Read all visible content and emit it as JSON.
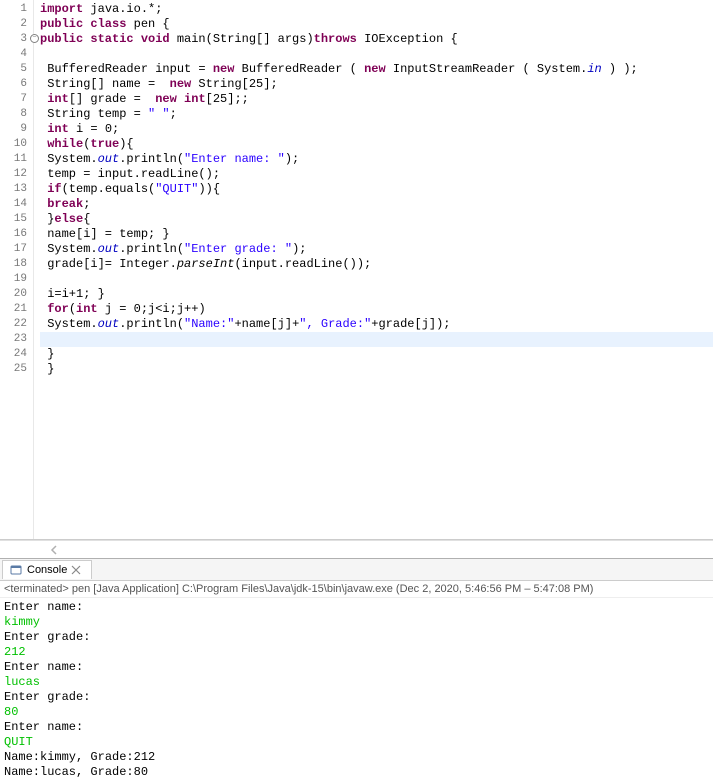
{
  "editor": {
    "lines": [
      {
        "n": 1,
        "tokens": [
          [
            "kw",
            "import"
          ],
          [
            "type",
            " java.io.*;"
          ]
        ]
      },
      {
        "n": 2,
        "tokens": [
          [
            "kw",
            "public class"
          ],
          [
            "type",
            " pen {"
          ]
        ]
      },
      {
        "n": 3,
        "fold": true,
        "tokens": [
          [
            "kw",
            "public static void"
          ],
          [
            "type",
            " main(String[] args)"
          ],
          [
            "kw",
            "throws"
          ],
          [
            "type",
            " IOException {"
          ]
        ]
      },
      {
        "n": 4,
        "tokens": []
      },
      {
        "n": 5,
        "tokens": [
          [
            "type",
            " BufferedReader input = "
          ],
          [
            "kw",
            "new"
          ],
          [
            "type",
            " BufferedReader ( "
          ],
          [
            "kw",
            "new"
          ],
          [
            "type",
            " InputStreamReader ( System."
          ],
          [
            "fld",
            "in"
          ],
          [
            "type",
            " ) );"
          ]
        ]
      },
      {
        "n": 6,
        "tokens": [
          [
            "type",
            " String[] name =  "
          ],
          [
            "kw",
            "new"
          ],
          [
            "type",
            " String[25];"
          ]
        ]
      },
      {
        "n": 7,
        "tokens": [
          [
            "kw",
            " int"
          ],
          [
            "type",
            "[] grade =  "
          ],
          [
            "kw",
            "new int"
          ],
          [
            "type",
            "[25];;"
          ]
        ]
      },
      {
        "n": 8,
        "tokens": [
          [
            "type",
            " String temp = "
          ],
          [
            "str",
            "\" \""
          ],
          [
            "type",
            ";"
          ]
        ]
      },
      {
        "n": 9,
        "tokens": [
          [
            "kw",
            " int"
          ],
          [
            "type",
            " i = 0;"
          ]
        ]
      },
      {
        "n": 10,
        "tokens": [
          [
            "kw",
            " while"
          ],
          [
            "type",
            "("
          ],
          [
            "kw",
            "true"
          ],
          [
            "type",
            "){"
          ]
        ]
      },
      {
        "n": 11,
        "tokens": [
          [
            "type",
            " System."
          ],
          [
            "fld",
            "out"
          ],
          [
            "type",
            ".println("
          ],
          [
            "str",
            "\"Enter name: \""
          ],
          [
            "type",
            ");"
          ]
        ]
      },
      {
        "n": 12,
        "tokens": [
          [
            "type",
            " temp = input.readLine();"
          ]
        ]
      },
      {
        "n": 13,
        "tokens": [
          [
            "kw",
            " if"
          ],
          [
            "type",
            "(temp.equals("
          ],
          [
            "str",
            "\"QUIT\""
          ],
          [
            "type",
            ")){"
          ]
        ]
      },
      {
        "n": 14,
        "tokens": [
          [
            "kw",
            " break"
          ],
          [
            "type",
            ";"
          ]
        ]
      },
      {
        "n": 15,
        "tokens": [
          [
            "type",
            " }"
          ],
          [
            "kw",
            "else"
          ],
          [
            "type",
            "{"
          ]
        ]
      },
      {
        "n": 16,
        "tokens": [
          [
            "type",
            " name[i] = temp; }"
          ]
        ]
      },
      {
        "n": 17,
        "tokens": [
          [
            "type",
            " System."
          ],
          [
            "fld",
            "out"
          ],
          [
            "type",
            ".println("
          ],
          [
            "str",
            "\"Enter grade: \""
          ],
          [
            "type",
            ");"
          ]
        ]
      },
      {
        "n": 18,
        "tokens": [
          [
            "type",
            " grade[i]= Integer."
          ],
          [
            "mth",
            "parseInt"
          ],
          [
            "type",
            "(input.readLine());"
          ]
        ]
      },
      {
        "n": 19,
        "tokens": []
      },
      {
        "n": 20,
        "tokens": [
          [
            "type",
            " i=i+1; }"
          ]
        ]
      },
      {
        "n": 21,
        "tokens": [
          [
            "kw",
            " for"
          ],
          [
            "type",
            "("
          ],
          [
            "kw",
            "int"
          ],
          [
            "type",
            " j = 0;j<i;j++)"
          ]
        ]
      },
      {
        "n": 22,
        "tokens": [
          [
            "type",
            " System."
          ],
          [
            "fld",
            "out"
          ],
          [
            "type",
            ".println("
          ],
          [
            "str",
            "\"Name:\""
          ],
          [
            "type",
            "+name[j]+"
          ],
          [
            "str",
            "\", Grade:\""
          ],
          [
            "type",
            "+grade[j]);"
          ]
        ]
      },
      {
        "n": 23,
        "highlight": true,
        "tokens": []
      },
      {
        "n": 24,
        "tokens": [
          [
            "type",
            " }"
          ]
        ]
      },
      {
        "n": 25,
        "tokens": [
          [
            "type",
            " }"
          ]
        ]
      }
    ]
  },
  "console": {
    "tab_label": "Console",
    "status": "<terminated> pen [Java Application] C:\\Program Files\\Java\\jdk-15\\bin\\javaw.exe (Dec 2, 2020, 5:46:56 PM – 5:47:08 PM)",
    "lines": [
      {
        "cls": "sys",
        "text": "Enter name: "
      },
      {
        "cls": "inp",
        "text": "kimmy"
      },
      {
        "cls": "sys",
        "text": "Enter grade: "
      },
      {
        "cls": "inp",
        "text": "212"
      },
      {
        "cls": "sys",
        "text": "Enter name: "
      },
      {
        "cls": "inp",
        "text": "lucas"
      },
      {
        "cls": "sys",
        "text": "Enter grade: "
      },
      {
        "cls": "inp",
        "text": "80"
      },
      {
        "cls": "sys",
        "text": "Enter name: "
      },
      {
        "cls": "inp",
        "text": "QUIT"
      },
      {
        "cls": "sys",
        "text": "Name:kimmy, Grade:212"
      },
      {
        "cls": "sys",
        "text": "Name:lucas, Grade:80"
      }
    ]
  }
}
